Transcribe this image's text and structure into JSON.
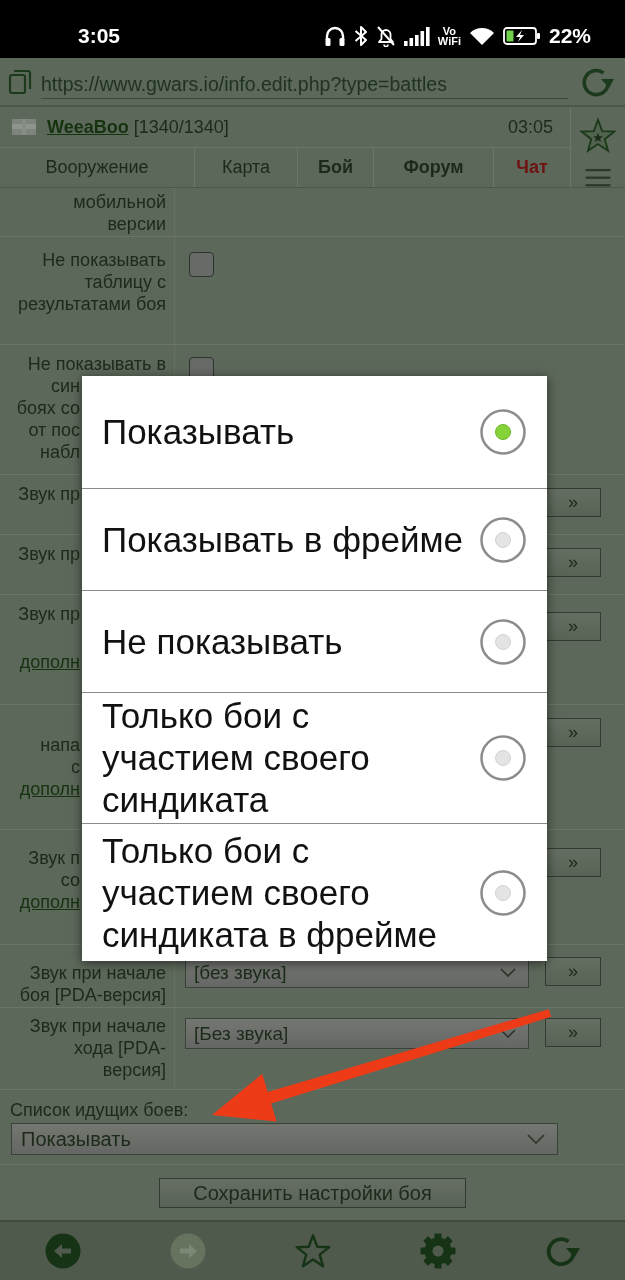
{
  "status_bar": {
    "time": "3:05",
    "wifi_calling": "Vo WiFi",
    "battery": "22%"
  },
  "browser": {
    "url": "https://www.gwars.io/info.edit.php?type=battles"
  },
  "header": {
    "user": "WeeaBoo",
    "health": "[1340/1340]",
    "clock": "03:05"
  },
  "nav": [
    {
      "label": "Вооружение",
      "kind": "plain"
    },
    {
      "label": "Карта",
      "kind": "plain"
    },
    {
      "label": "Бой",
      "kind": "bold"
    },
    {
      "label": "Форум",
      "kind": "bold"
    },
    {
      "label": "Чат",
      "kind": "alert"
    }
  ],
  "settings": [
    {
      "kind": "text",
      "label": "мобильной версии"
    },
    {
      "kind": "checkbox",
      "label": "Не показывать таблицу с результатами боя",
      "checked": false
    },
    {
      "kind": "checkbox",
      "label": "Не показывать в",
      "fragments": [
        "син",
        "боях со",
        "от пос",
        "набл"
      ],
      "checked": false
    },
    {
      "kind": "button",
      "fragments": [
        "Звук пр"
      ],
      "button": "»"
    },
    {
      "kind": "button",
      "fragments": [
        "Звук пр"
      ],
      "button": "»"
    },
    {
      "kind": "button",
      "fragments": [
        "Звук пр"
      ],
      "link": "дополн",
      "button": "»"
    },
    {
      "kind": "button",
      "fragments": [
        "напа",
        "с"
      ],
      "link": "дополн",
      "button": "»"
    },
    {
      "kind": "button",
      "fragments": [
        "Звук п",
        "со"
      ],
      "link": "дополн",
      "button": "»"
    },
    {
      "kind": "select",
      "label": "Звук при начале боя [PDA-версия]",
      "value": "[без звука]",
      "button": "»"
    },
    {
      "kind": "select",
      "label": "Звук при начале хода [PDA-версия]",
      "value": "[Без звука]",
      "button": "»"
    }
  ],
  "battle_list": {
    "label": "Список идущих боев:",
    "value": "Показывать"
  },
  "save_button": "Сохранить настройки боя",
  "toolbar": [
    {
      "kind": "back",
      "disabled": false
    },
    {
      "kind": "forward",
      "disabled": true
    },
    {
      "kind": "bookmark",
      "disabled": false
    },
    {
      "kind": "settings",
      "disabled": false
    },
    {
      "kind": "reload",
      "disabled": false
    }
  ],
  "dialog": {
    "options": [
      {
        "label": "Показывать",
        "selected": true
      },
      {
        "label": "Показывать в фрейме",
        "selected": false
      },
      {
        "label": "Не показывать",
        "selected": false
      },
      {
        "label": "Только бои с участием своего синдиката",
        "selected": false
      },
      {
        "label": "Только бои с участием своего синдиката в фрейме",
        "selected": false
      }
    ]
  }
}
